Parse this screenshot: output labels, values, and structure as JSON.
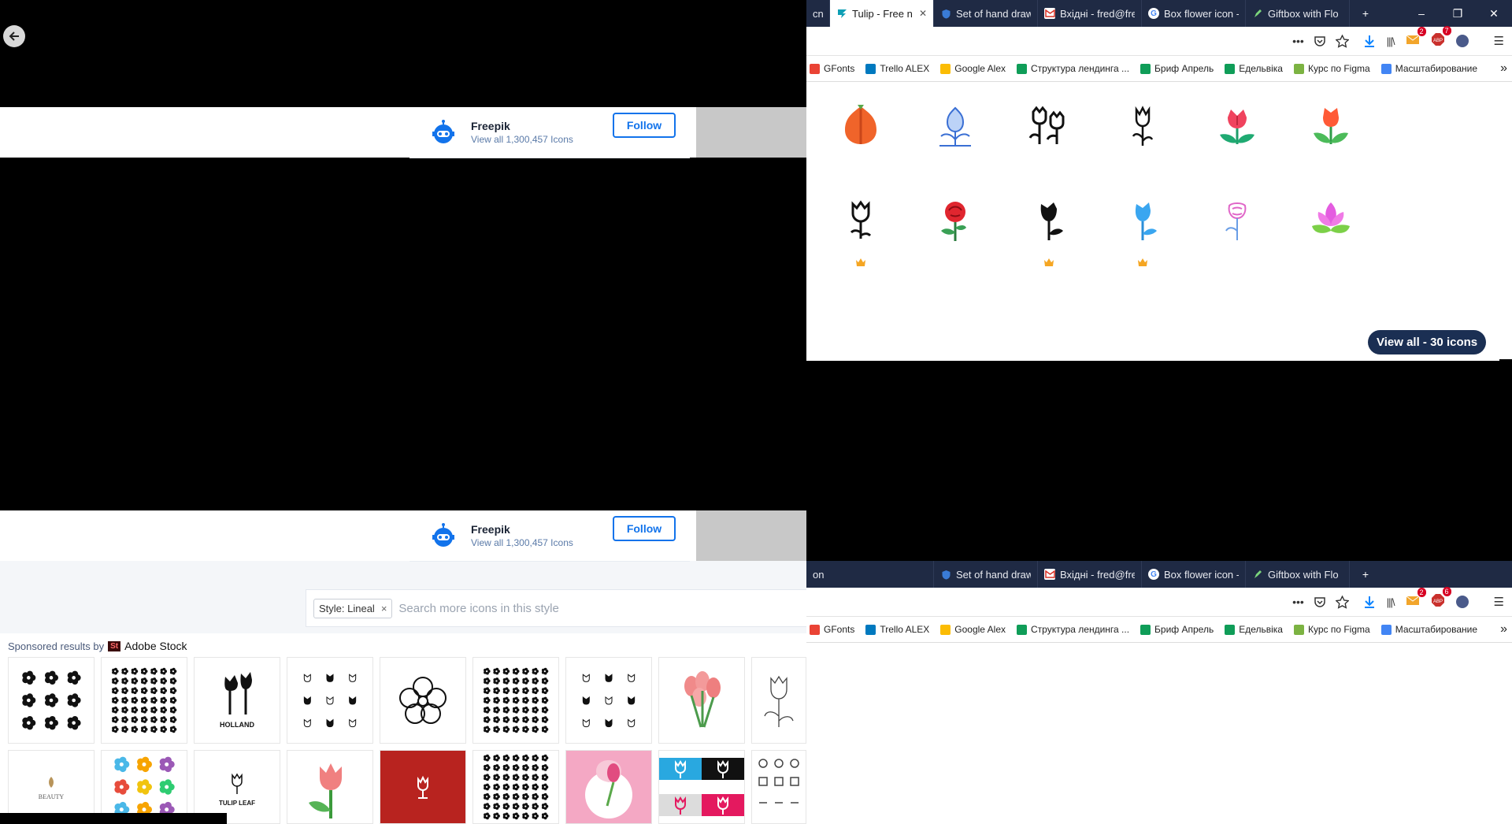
{
  "browser": {
    "tabs": [
      {
        "label": "cn",
        "favicon": "partial"
      },
      {
        "label": "Tulip - Free n",
        "favicon": "flaticon",
        "active": true
      },
      {
        "label": "Set of hand draw",
        "favicon": "shield"
      },
      {
        "label": "Вхідні - fred@fre",
        "favicon": "gmail"
      },
      {
        "label": "Box flower icon -",
        "favicon": "google"
      },
      {
        "label": "Giftbox with Flo",
        "favicon": "pencil"
      }
    ],
    "tabs_second": [
      {
        "label": "on",
        "favicon": "partial"
      },
      {
        "label": "Set of hand draw",
        "favicon": "shield"
      },
      {
        "label": "Вхідні - fred@fre",
        "favicon": "gmail"
      },
      {
        "label": "Box flower icon -",
        "favicon": "google"
      },
      {
        "label": "Giftbox with Flo",
        "favicon": "pencil"
      }
    ],
    "new_tab": "+",
    "window_controls": {
      "minimize": "–",
      "restore": "❐",
      "close": "✕"
    },
    "toolbar": {
      "more": "•••",
      "library": "|||\\",
      "mail_badge": "2",
      "abp_badge": "7",
      "abp_badge_second": "6",
      "abp_label": "ABP",
      "menu": "☰"
    },
    "bookmarks": [
      {
        "label": "GFonts",
        "color": "#ea4335"
      },
      {
        "label": "Trello ALEX",
        "color": "#0079bf"
      },
      {
        "label": "Google Alex",
        "color": "#fbbc04"
      },
      {
        "label": "Структура лендинга ...",
        "color": "#0f9d58"
      },
      {
        "label": "Бриф Апрель",
        "color": "#0f9d58"
      },
      {
        "label": "Едельвіка",
        "color": "#0f9d58"
      },
      {
        "label": "Курс по Figma",
        "color": "#7cb342"
      },
      {
        "label": "Масштабирование",
        "color": "#4285f4"
      }
    ],
    "bookmarks_overflow": "»"
  },
  "author": {
    "name": "Freepik",
    "subtitle": "View all 1,300,457 Icons",
    "follow_label": "Follow"
  },
  "icon_grid": {
    "icons": [
      {
        "name": "orange-tulip-bud-icon",
        "premium": false
      },
      {
        "name": "blue-outline-tulip-icon",
        "premium": false
      },
      {
        "name": "double-tulip-outline-icon",
        "premium": false
      },
      {
        "name": "single-tulip-outline-icon",
        "premium": false
      },
      {
        "name": "red-tulip-icon",
        "premium": false
      },
      {
        "name": "orange-tulip-icon",
        "premium": false
      },
      {
        "name": "tulip-lineal-icon",
        "premium": true
      },
      {
        "name": "red-rose-icon",
        "premium": false
      },
      {
        "name": "black-tulip-icon",
        "premium": true
      },
      {
        "name": "blue-tulip-icon",
        "premium": true
      },
      {
        "name": "pink-rose-outline-icon",
        "premium": false
      },
      {
        "name": "pink-lotus-icon",
        "premium": false
      }
    ],
    "view_all_label": "View all - 30 icons"
  },
  "search": {
    "style_chip": "Style: Lineal",
    "chip_close": "×",
    "placeholder": "Search more icons in this style"
  },
  "sponsored": {
    "prefix": "Sponsored results by",
    "brand_badge": "St",
    "brand": "Adobe Stock",
    "thumbs_row1": [
      "flower-silhouettes",
      "flower-icon-set",
      "holland-tulips",
      "tulip-icon-set",
      "flower-outline",
      "flower-collection",
      "hand-drawn-flowers",
      "pink-tulip-bouquet",
      "tulip-sketch"
    ],
    "thumbs_row2": [
      "beauty-logo",
      "colorful-flowers",
      "tulip-leaf-logo",
      "tulip-illustration",
      "red-tulip-logo",
      "flower-pattern-set",
      "pink-8-march",
      "blue-pink-tulip-tiles",
      "lineal-icon-set"
    ],
    "holland_text": "HOLLAND",
    "beauty_text": "BEAUTY",
    "tulip_leaf_text": "TULIP LEAF"
  },
  "colors": {
    "chrome": "#1f2a44",
    "accent": "#1273eb",
    "view_all_bg": "#1b2f53",
    "premium": "#f5a623",
    "adobe": "#da1f26"
  }
}
